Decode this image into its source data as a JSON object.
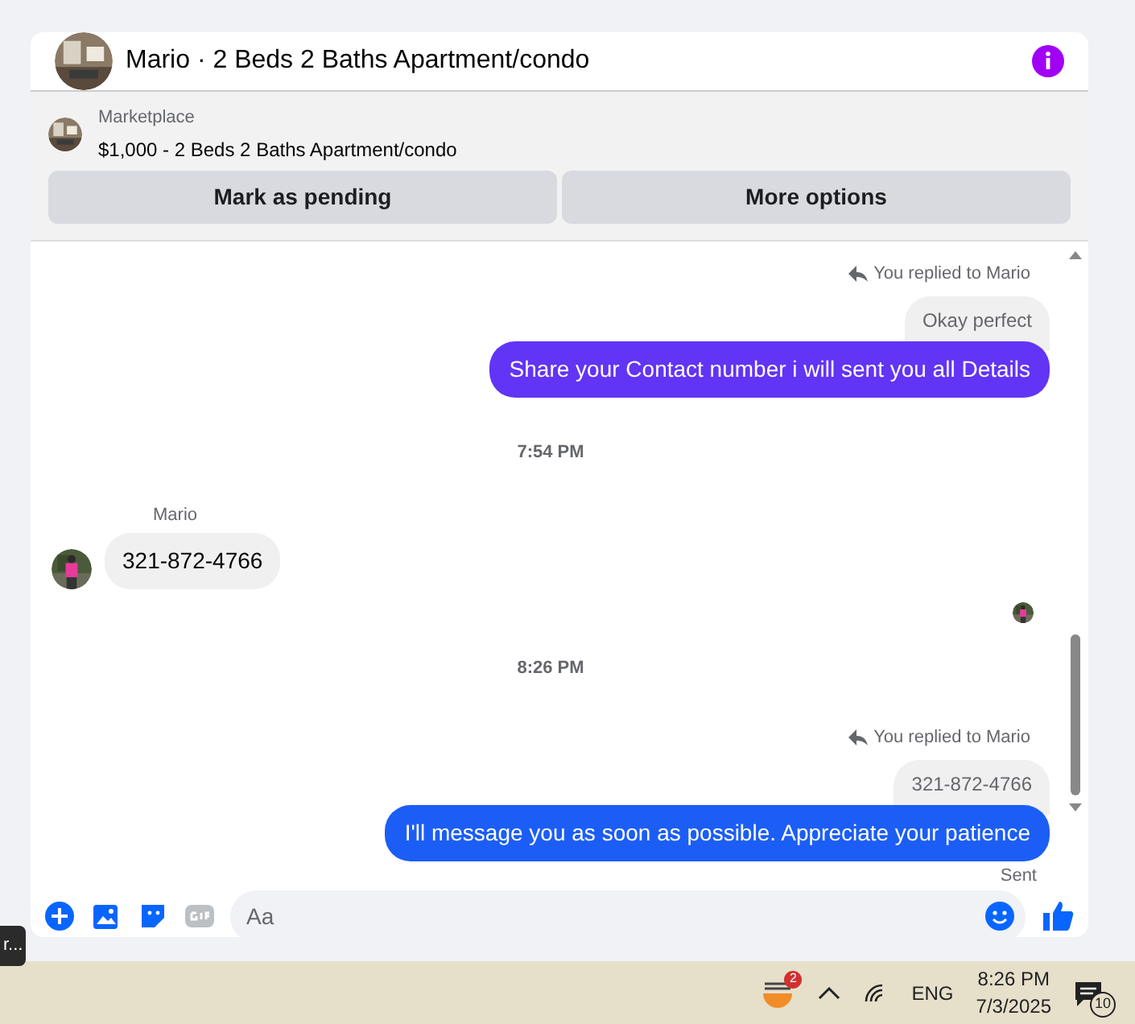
{
  "header": {
    "title": "Mario · 2 Beds 2 Baths Apartment/condo"
  },
  "listing": {
    "source": "Marketplace",
    "title": "$1,000 - 2 Beds 2 Baths Apartment/condo",
    "buttons": [
      "Mark as pending",
      "More options"
    ]
  },
  "messages": [
    {
      "kind": "reply_note",
      "text": "You replied to Mario"
    },
    {
      "kind": "quoted",
      "text": "Okay perfect"
    },
    {
      "kind": "outgoing",
      "text": "Share your Contact number i will sent you all Details",
      "color": "#6234f5"
    },
    {
      "kind": "time",
      "text": "7:54 PM"
    },
    {
      "kind": "sender",
      "text": "Mario"
    },
    {
      "kind": "incoming",
      "text": "321-872-4766"
    },
    {
      "kind": "seen"
    },
    {
      "kind": "time",
      "text": "8:26 PM"
    },
    {
      "kind": "reply_note",
      "text": "You replied to Mario"
    },
    {
      "kind": "quoted",
      "text": "321-872-4766"
    },
    {
      "kind": "outgoing",
      "text": "I'll message you as soon as possible. Appreciate your patience",
      "color": "#1c5ef5"
    },
    {
      "kind": "status",
      "text": "Sent"
    }
  ],
  "composer": {
    "placeholder": "Aa"
  },
  "tooltip": "r...",
  "taskbar": {
    "badge": "2",
    "language": "ENG",
    "time": "8:26 PM",
    "date": "7/3/2025",
    "notifications": "10"
  }
}
